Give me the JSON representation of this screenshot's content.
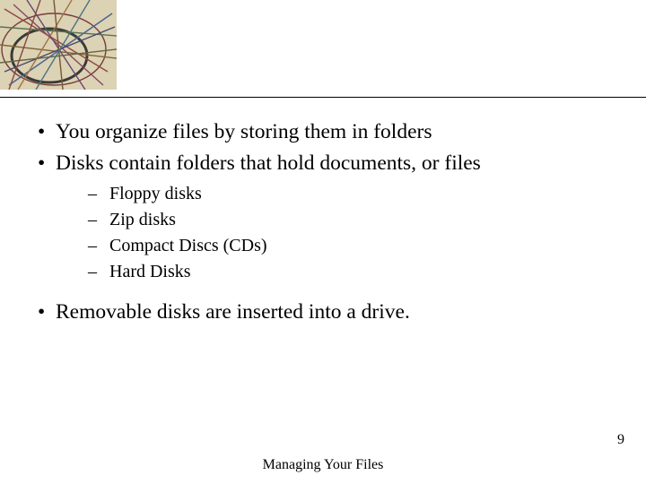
{
  "bullets": {
    "b1": "You organize files by storing them in folders",
    "b2": "Disks contain folders that hold documents, or files",
    "sub": {
      "s1": "Floppy disks",
      "s2": "Zip disks",
      "s3": "Compact Discs (CDs)",
      "s4": "Hard Disks"
    },
    "b3": "Removable disks are inserted into a drive."
  },
  "footer": {
    "title": "Managing Your Files",
    "page": "9"
  }
}
